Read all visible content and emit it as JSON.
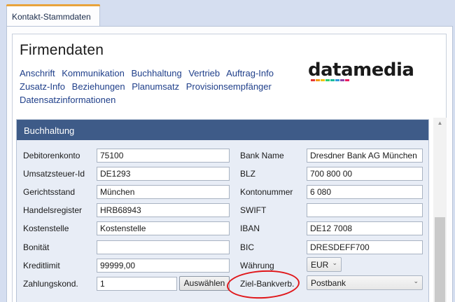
{
  "tab": {
    "label": "Kontakt-Stammdaten"
  },
  "page": {
    "title": "Firmendaten"
  },
  "nav": {
    "links": [
      "Anschrift",
      "Kommunikation",
      "Buchhaltung",
      "Vertrieb",
      "Auftrag-Info",
      "Zusatz-Info",
      "Beziehungen",
      "Planumsatz",
      "Provisionsempfänger",
      "Datensatzinformationen"
    ]
  },
  "logo": {
    "text": "datamedia",
    "bar_colors": [
      "#e53935",
      "#f39c12",
      "#f1c40f",
      "#2ecc71",
      "#1abc9c",
      "#3498db",
      "#8e44ad",
      "#e91e63"
    ]
  },
  "section": {
    "title": "Buchhaltung"
  },
  "left_fields": [
    {
      "label": "Debitorenkonto",
      "value": "75100"
    },
    {
      "label": "Umsatzsteuer-Id",
      "value": "DE1293"
    },
    {
      "label": "Gerichtsstand",
      "value": "München"
    },
    {
      "label": "Handelsregister",
      "value": "HRB68943"
    },
    {
      "label": "Kostenstelle",
      "value": "Kostenstelle"
    },
    {
      "label": "Bonität",
      "value": ""
    },
    {
      "label": "Kreditlimit",
      "value": "99999,00"
    },
    {
      "label": "Zahlungskond.",
      "value": "1",
      "button": "Auswählen"
    }
  ],
  "right_fields": [
    {
      "label": "Bank Name",
      "value": "Dresdner Bank AG München"
    },
    {
      "label": "BLZ",
      "value": "700 800 00"
    },
    {
      "label": "Kontonummer",
      "value": "6 080"
    },
    {
      "label": "SWIFT",
      "value": ""
    },
    {
      "label": "IBAN",
      "value": "DE12 7008"
    },
    {
      "label": "BIC",
      "value": "DRESDEFF700"
    },
    {
      "label": "Währung",
      "value": "EUR",
      "type": "select"
    },
    {
      "label": "Ziel-Bankverb.",
      "value": "Postbank",
      "type": "select"
    }
  ],
  "colors": {
    "header": "#3e5b88",
    "link": "#1f3f8a",
    "highlight": "#e0161a",
    "tab_accent": "#e8a33b"
  },
  "icons": {
    "dropdown": "chevron-down-icon",
    "scroll_up": "scroll-up-icon"
  }
}
